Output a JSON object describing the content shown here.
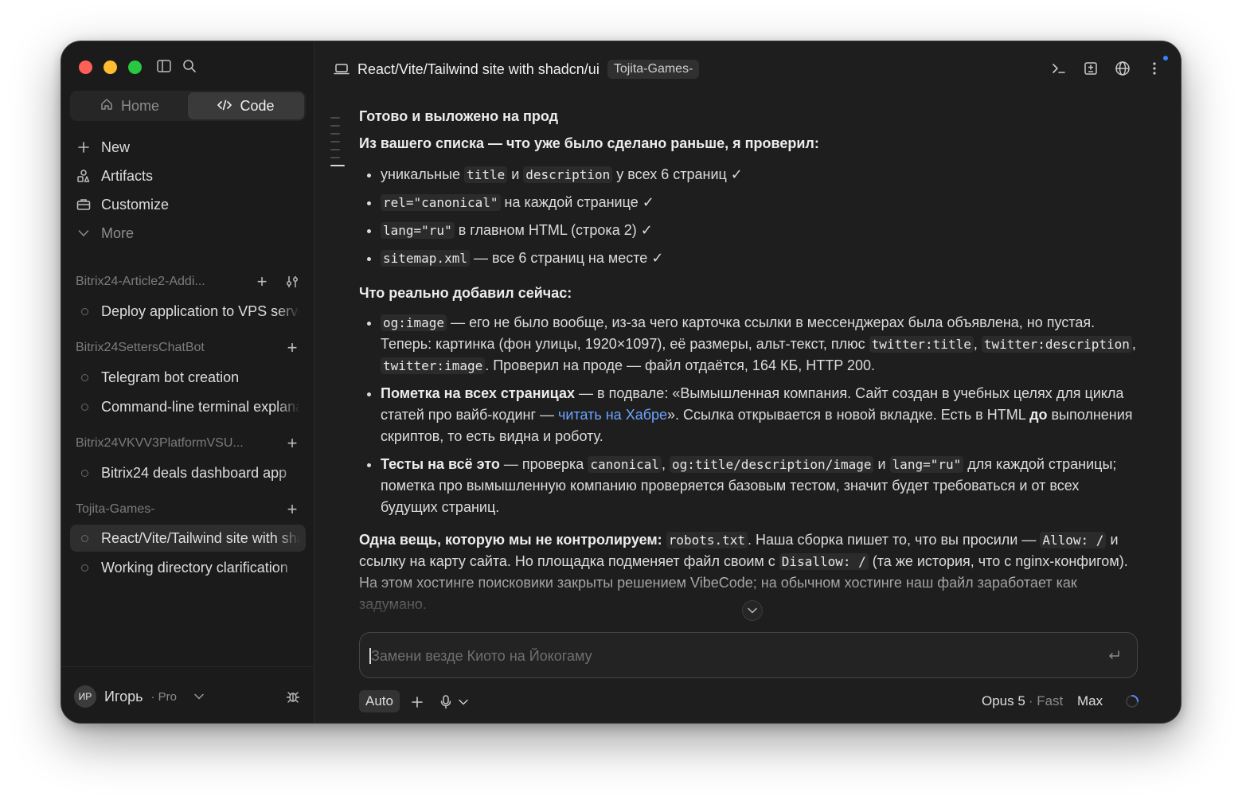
{
  "sidebar": {
    "tabs": [
      {
        "label": "Home"
      },
      {
        "label": "Code"
      }
    ],
    "nav": [
      {
        "label": "New"
      },
      {
        "label": "Artifacts"
      },
      {
        "label": "Customize"
      },
      {
        "label": "More"
      }
    ],
    "groups": [
      {
        "title": "Bitrix24-Article2-Addi...",
        "chats": [
          {
            "title": "Deploy application to VPS server"
          }
        ]
      },
      {
        "title": "Bitrix24SettersChatBot",
        "chats": [
          {
            "title": "Telegram bot creation"
          },
          {
            "title": "Command-line terminal explanation"
          }
        ]
      },
      {
        "title": "Bitrix24VKVV3PlatformVSU...",
        "chats": [
          {
            "title": "Bitrix24 deals dashboard app"
          }
        ]
      },
      {
        "title": "Tojita-Games-",
        "chats": [
          {
            "title": "React/Vite/Tailwind site with shadcn/ui"
          },
          {
            "title": "Working directory clarification"
          }
        ]
      }
    ],
    "user": {
      "initials": "ИР",
      "name": "Игорь",
      "plan": "· Pro"
    }
  },
  "header": {
    "title": "React/Vite/Tailwind site with shadcn/ui",
    "tag": "Tojita-Games-"
  },
  "message": {
    "heading": "Готово и выложено на прод",
    "intro": "Из вашего списка — что уже было сделано раньше, я проверил:",
    "checked": {
      "i1_a": "уникальные ",
      "i1_code1": "title",
      "i1_b": " и ",
      "i1_code2": "description",
      "i1_c": " у всех 6 страниц ✓",
      "i2_code": "rel=\"canonical\"",
      "i2_a": " на каждой странице ✓",
      "i3_code": "lang=\"ru\"",
      "i3_a": " в главном HTML (строка 2) ✓",
      "i4_code": "sitemap.xml",
      "i4_a": " — все 6 страниц на месте ✓"
    },
    "added_heading": "Что реально добавил сейчас:",
    "added": {
      "a1_code1": "og:image",
      "a1_a": " — его не было вообще, из-за чего карточка ссылки в мессенджерах была объявлена, но пустая. Теперь: картинка (фон улицы, 1920×1097), её размеры, альт-текст, плюс ",
      "a1_code2": "twitter:title",
      "a1_b": ", ",
      "a1_code3": "twitter:description",
      "a1_c": ", ",
      "a1_code4": "twitter:image",
      "a1_d": ". Проверил на проде — файл отдаётся, 164 КБ, HTTP 200.",
      "a2_bold": "Пометка на всех страницах",
      "a2_a": " — в подвале: «Вымышленная компания. Сайт создан в учебных целях для цикла статей про вайб-кодинг — ",
      "a2_link": "читать на Хабре",
      "a2_b": "». Ссылка открывается в новой вкладке. Есть в HTML ",
      "a2_bold2": "до",
      "a2_c": " выполнения скриптов, то есть видна и роботу.",
      "a3_bold": "Тесты на всё это",
      "a3_a": " — проверка ",
      "a3_code1": "canonical",
      "a3_b": ", ",
      "a3_code2": "og:title/description/image",
      "a3_c": " и ",
      "a3_code3": "lang=\"ru\"",
      "a3_d": " для каждой страницы; пометка про вымышленную компанию проверяется базовым тестом, значит будет требоваться и от всех будущих страниц."
    },
    "final": {
      "bold": "Одна вещь, которую мы не контролируем:",
      "a": " ",
      "code1": "robots.txt",
      "b": ". Наша сборка пишет то, что вы просили — ",
      "code2": "Allow: /",
      "c": " и ссылку на карту сайта. Но площадка подменяет файл своим с ",
      "code3": "Disallow: /",
      "d": " (та же история, что с nginx-конфигом). На этом хостинге поисковики закрыты решением VibeCode; на обычном хостинге наш файл заработает как задумано."
    }
  },
  "composer": {
    "placeholder": "Замени везде Киото на Йокогаму",
    "mode": "Auto",
    "model": "Opus 5",
    "speed": "· Fast",
    "effort": "Max"
  }
}
